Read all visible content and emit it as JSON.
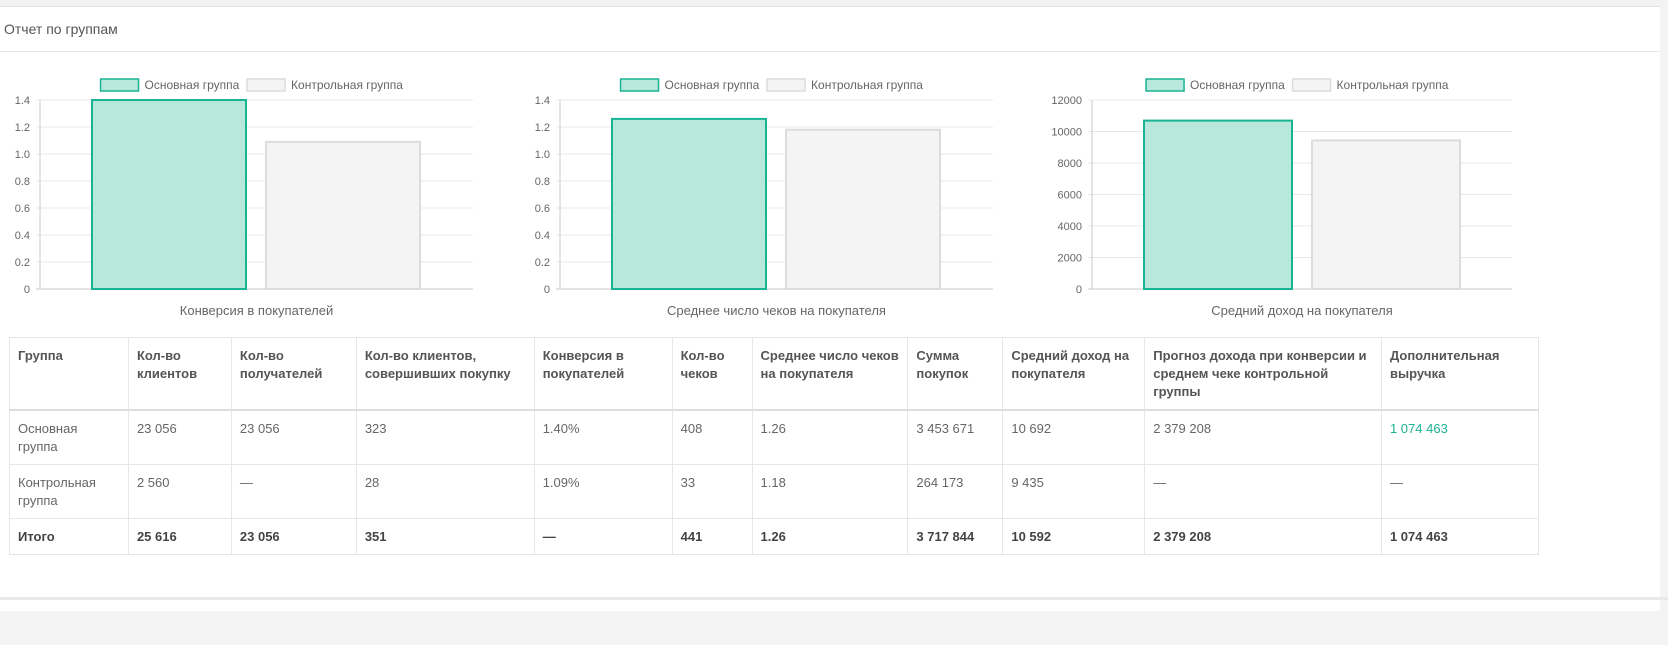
{
  "panel": {
    "title": "Отчет по группам"
  },
  "colors": {
    "main_fill": "#b8e7dc",
    "main_stroke": "#1ab394",
    "control_fill": "#f4f4f4",
    "control_stroke": "#dcdcdc",
    "accent": "#1ab394"
  },
  "legend": [
    "Основная группа",
    "Контрольная группа"
  ],
  "chart_data": [
    {
      "type": "bar",
      "categories": [
        "Основная группа",
        "Контрольная группа"
      ],
      "series": [
        {
          "name": "Основная группа",
          "values": [
            1.4
          ]
        },
        {
          "name": "Контрольная группа",
          "values": [
            1.09
          ]
        }
      ],
      "xlabel": "Конверсия в покупателей",
      "ylim": [
        0,
        1.4
      ],
      "yticks": [
        "0",
        "0.2",
        "0.4",
        "0.6",
        "0.8",
        "1.0",
        "1.2",
        "1.4"
      ],
      "ytick_values": [
        0,
        0.2,
        0.4,
        0.6,
        0.8,
        1.0,
        1.2,
        1.4
      ],
      "legend_position": "top"
    },
    {
      "type": "bar",
      "categories": [
        "Основная группа",
        "Контрольная группа"
      ],
      "series": [
        {
          "name": "Основная группа",
          "values": [
            1.26
          ]
        },
        {
          "name": "Контрольная группа",
          "values": [
            1.18
          ]
        }
      ],
      "xlabel": "Среднее число чеков на покупателя",
      "ylim": [
        0,
        1.4
      ],
      "yticks": [
        "0",
        "0.2",
        "0.4",
        "0.6",
        "0.8",
        "1.0",
        "1.2",
        "1.4"
      ],
      "ytick_values": [
        0,
        0.2,
        0.4,
        0.6,
        0.8,
        1.0,
        1.2,
        1.4
      ],
      "legend_position": "top"
    },
    {
      "type": "bar",
      "categories": [
        "Основная группа",
        "Контрольная группа"
      ],
      "series": [
        {
          "name": "Основная группа",
          "values": [
            10692
          ]
        },
        {
          "name": "Контрольная группа",
          "values": [
            9435
          ]
        }
      ],
      "xlabel": "Средний доход на покупателя",
      "ylim": [
        0,
        12000
      ],
      "yticks": [
        "0",
        "2000",
        "4000",
        "6000",
        "8000",
        "10000",
        "12000"
      ],
      "ytick_values": [
        0,
        2000,
        4000,
        6000,
        8000,
        10000,
        12000
      ],
      "legend_position": "top"
    }
  ],
  "table": {
    "headers": [
      "Группа",
      "Кол-во клиентов",
      "Кол-во получателей",
      "Кол-во клиентов, совершивших покупку",
      "Конверсия в покупателей",
      "Кол-во чеков",
      "Среднее число чеков на покупателя",
      "Сумма покупок",
      "Средний доход на покупателя",
      "Прогноз дохода при конверсии и среднем чеке контрольной группы",
      "Дополнительная выручка"
    ],
    "rows": [
      [
        "Основная группа",
        "23 056",
        "23 056",
        "323",
        "1.40%",
        "408",
        "1.26",
        "3 453 671",
        "10 692",
        "2 379 208",
        "1 074 463"
      ],
      [
        "Контрольная группа",
        "2 560",
        "—",
        "28",
        "1.09%",
        "33",
        "1.18",
        "264 173",
        "9 435",
        "—",
        "—"
      ]
    ],
    "total": [
      "Итого",
      "25 616",
      "23 056",
      "351",
      "—",
      "441",
      "1.26",
      "3 717 844",
      "10 592",
      "2 379 208",
      "1 074 463"
    ]
  }
}
